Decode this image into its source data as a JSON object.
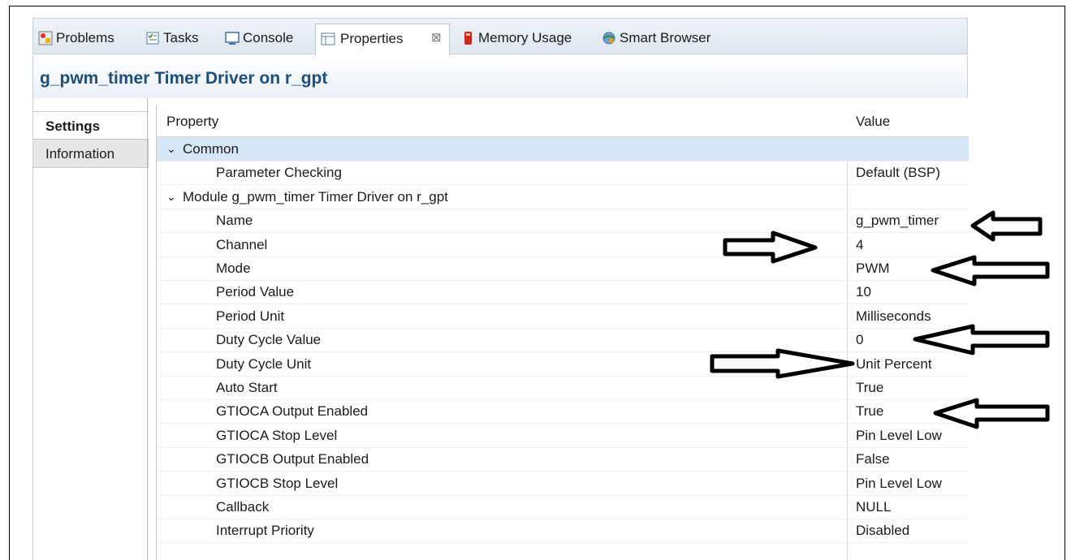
{
  "tabs": [
    {
      "label": "Problems",
      "icon": "problems-icon"
    },
    {
      "label": "Tasks",
      "icon": "tasks-icon"
    },
    {
      "label": "Console",
      "icon": "console-icon"
    },
    {
      "label": "Properties",
      "icon": "properties-icon",
      "active": true,
      "close": "⊠"
    },
    {
      "label": "Memory Usage",
      "icon": "memory-icon"
    },
    {
      "label": "Smart Browser",
      "icon": "smart-browser-icon"
    }
  ],
  "view_title": "g_pwm_timer Timer Driver on r_gpt",
  "side_tabs": {
    "settings": "Settings",
    "information": "Information"
  },
  "table": {
    "headers": {
      "property": "Property",
      "value": "Value"
    },
    "rows": [
      {
        "property": "Common",
        "value": "",
        "group": true
      },
      {
        "property": "Parameter Checking",
        "value": "Default (BSP)"
      },
      {
        "property": "Module g_pwm_timer Timer Driver on r_gpt",
        "value": "",
        "group": true
      },
      {
        "property": "Name",
        "value": "g_pwm_timer"
      },
      {
        "property": "Channel",
        "value": "4"
      },
      {
        "property": "Mode",
        "value": "PWM"
      },
      {
        "property": "Period Value",
        "value": "10"
      },
      {
        "property": "Period Unit",
        "value": "Milliseconds"
      },
      {
        "property": "Duty Cycle Value",
        "value": "0"
      },
      {
        "property": "Duty Cycle Unit",
        "value": "Unit Percent"
      },
      {
        "property": "Auto Start",
        "value": "True"
      },
      {
        "property": "GTIOCA Output Enabled",
        "value": "True"
      },
      {
        "property": "GTIOCA Stop Level",
        "value": "Pin Level Low"
      },
      {
        "property": "GTIOCB Output Enabled",
        "value": "False"
      },
      {
        "property": "GTIOCB Stop Level",
        "value": "Pin Level Low"
      },
      {
        "property": "Callback",
        "value": "NULL"
      },
      {
        "property": "Interrupt Priority",
        "value": "Disabled"
      }
    ]
  },
  "colors": {
    "title": "#1e4e79",
    "selected_row": "#d6e8f7"
  }
}
